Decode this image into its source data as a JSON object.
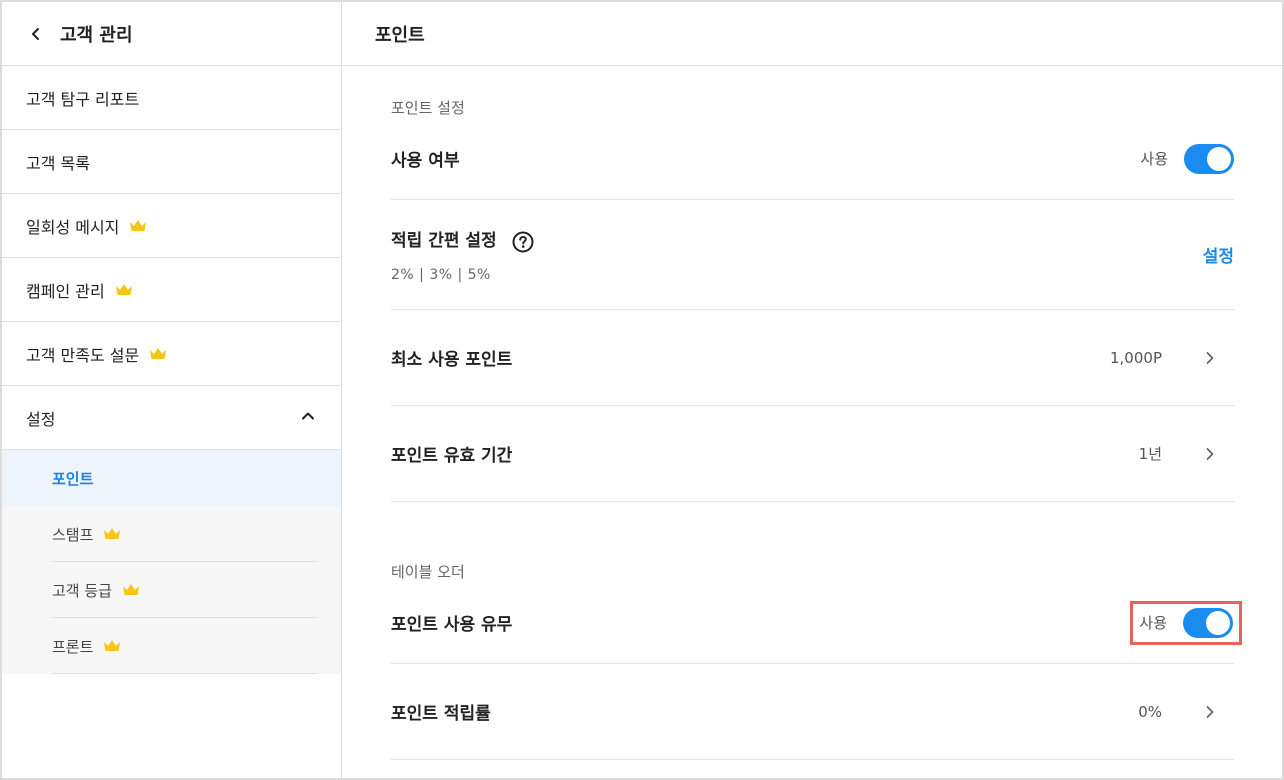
{
  "sidebar": {
    "title": "고객 관리",
    "items": [
      {
        "label": "고객 탐구 리포트",
        "premium": false
      },
      {
        "label": "고객 목록",
        "premium": false
      },
      {
        "label": "일회성 메시지",
        "premium": true
      },
      {
        "label": "캠페인 관리",
        "premium": true
      },
      {
        "label": "고객 만족도 설문",
        "premium": true
      }
    ],
    "settings_group": {
      "label": "설정",
      "expanded": true,
      "sub_items": [
        {
          "label": "포인트",
          "active": true,
          "premium": false
        },
        {
          "label": "스탬프",
          "active": false,
          "premium": true
        },
        {
          "label": "고객 등급",
          "active": false,
          "premium": true
        },
        {
          "label": "프론트",
          "active": false,
          "premium": true
        }
      ]
    }
  },
  "main": {
    "title": "포인트",
    "point_settings": {
      "section_label": "포인트 설정",
      "usage": {
        "title": "사용 여부",
        "toggle_label": "사용",
        "enabled": true
      },
      "quick_accrual": {
        "title": "적립 간편 설정",
        "rates": "2%  |  3%  |  5%",
        "action": "설정"
      },
      "min_use": {
        "title": "최소 사용 포인트",
        "value": "1,000P"
      },
      "validity": {
        "title": "포인트 유효 기간",
        "value": "1년"
      }
    },
    "table_order": {
      "section_label": "테이블 오더",
      "point_usage": {
        "title": "포인트 사용 유무",
        "toggle_label": "사용",
        "enabled": true
      },
      "accrual_rate": {
        "title": "포인트 적립률",
        "value": "0%"
      }
    }
  },
  "colors": {
    "accent": "#1a8cf0",
    "active_text": "#1a7fe0",
    "crown": "#f5c518",
    "highlight": "#e8645a"
  }
}
